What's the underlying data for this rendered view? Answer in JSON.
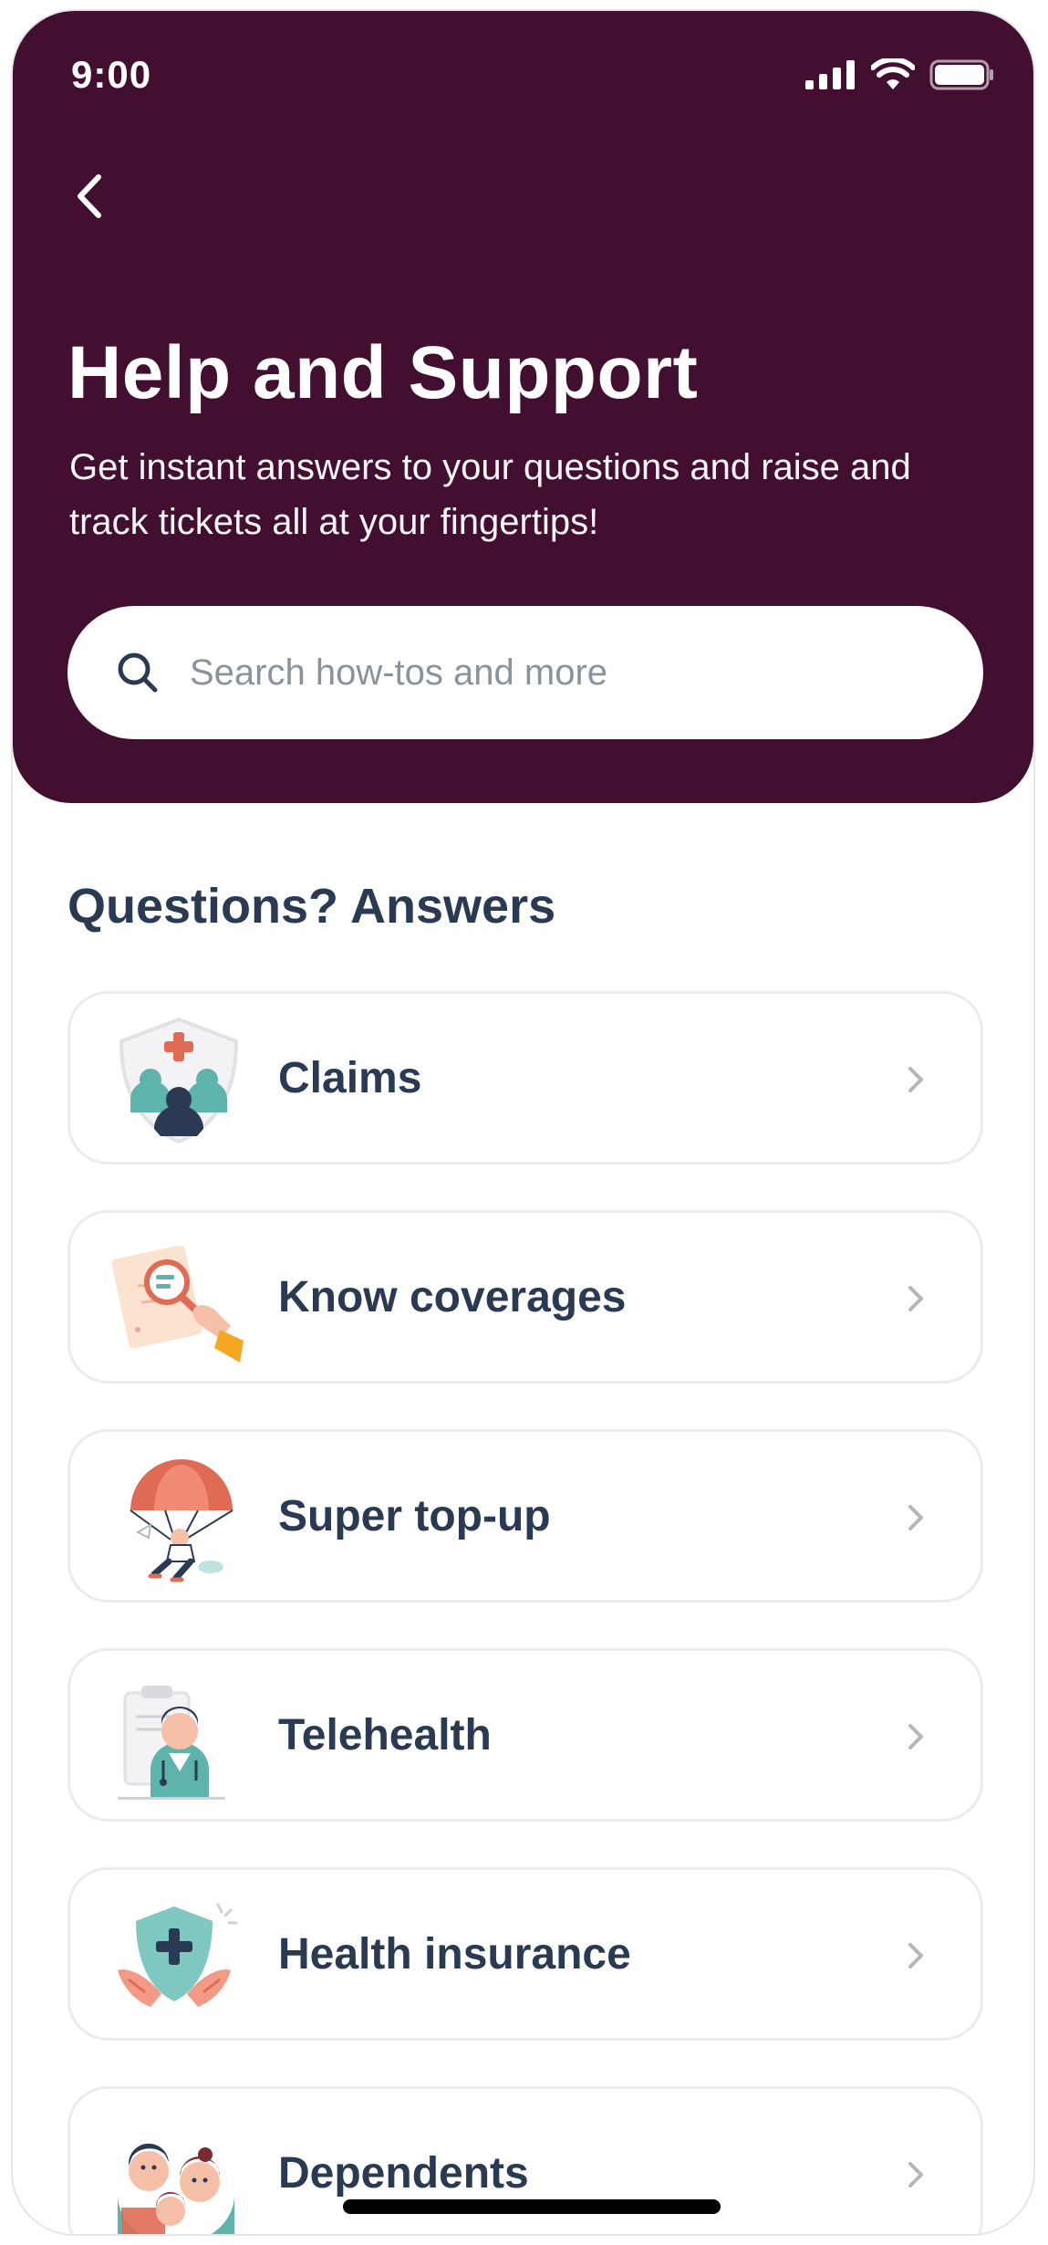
{
  "status_bar": {
    "time": "9:00",
    "icons": [
      "signal-icon",
      "wifi-icon",
      "battery-icon"
    ]
  },
  "header": {
    "back_icon": "chevron-left-icon",
    "title": "Help and Support",
    "subtitle": "Get instant answers to your questions and raise and track tickets all at your fingertips!"
  },
  "search": {
    "icon": "search-icon",
    "placeholder": "Search how-tos and more",
    "value": ""
  },
  "section": {
    "title": "Questions? Answers"
  },
  "topics": [
    {
      "label": "Claims",
      "icon": "claims-shield-icon"
    },
    {
      "label": "Know coverages",
      "icon": "magnifier-document-icon"
    },
    {
      "label": "Super top-up",
      "icon": "parachute-icon"
    },
    {
      "label": "Telehealth",
      "icon": "doctor-icon"
    },
    {
      "label": "Health insurance",
      "icon": "shield-hands-icon"
    },
    {
      "label": "Dependents",
      "icon": "family-icon"
    }
  ],
  "colors": {
    "header_bg": "#420f30",
    "text_dark": "#2a3a52",
    "placeholder": "#8a929e",
    "card_border": "#ececef",
    "accent_red": "#e06b55",
    "accent_teal": "#5fb3ad"
  }
}
